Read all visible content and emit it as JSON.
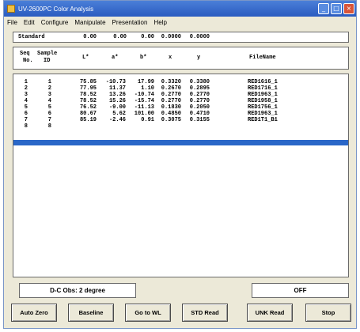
{
  "window": {
    "title": "UV-2600PC Color Analysis",
    "minimize": "_",
    "maximize": "□",
    "close": "×"
  },
  "menu": [
    "File",
    "Edit",
    "Configure",
    "Manipulate",
    "Presentation",
    "Help"
  ],
  "standard": {
    "label": "Standard",
    "values": [
      "0.00",
      "0.00",
      "0.00",
      "0.0000",
      "0.0000"
    ]
  },
  "columns": {
    "seq": [
      "Seq",
      "No."
    ],
    "sample": [
      "Sample",
      "ID"
    ],
    "labels": [
      "L*",
      "a*",
      "b*",
      "x",
      "y"
    ],
    "filename": "FileName"
  },
  "rows": [
    {
      "seq": "1",
      "sample": "1",
      "L": "75.85",
      "a": "-10.73",
      "b": "17.99",
      "x": "0.3320",
      "y": "0.3380",
      "file": "RED1616_1"
    },
    {
      "seq": "2",
      "sample": "2",
      "L": "77.95",
      "a": "11.37",
      "b": "1.10",
      "x": "0.2670",
      "y": "0.2895",
      "file": "RED1716_1"
    },
    {
      "seq": "3",
      "sample": "3",
      "L": "78.52",
      "a": "13.26",
      "b": "-10.74",
      "x": "0.2770",
      "y": "0.2770",
      "file": "RED1963_1"
    },
    {
      "seq": "4",
      "sample": "4",
      "L": "78.52",
      "a": "15.26",
      "b": "-15.74",
      "x": "0.2770",
      "y": "0.2770",
      "file": "RED1958_1"
    },
    {
      "seq": "5",
      "sample": "5",
      "L": "76.52",
      "a": "-9.00",
      "b": "-11.13",
      "x": "0.1830",
      "y": "0.2050",
      "file": "RED1756_1"
    },
    {
      "seq": "6",
      "sample": "6",
      "L": "80.67",
      "a": "5.62",
      "b": "101.00",
      "x": "0.4850",
      "y": "0.4710",
      "file": "RED1963_1"
    },
    {
      "seq": "7",
      "sample": "7",
      "L": "85.19",
      "a": "-2.46",
      "b": "0.91",
      "x": "0.3075",
      "y": "0.3155",
      "file": "RED1T1_B1"
    },
    {
      "seq": "8",
      "sample": "8",
      "L": "",
      "a": "",
      "b": "",
      "x": "",
      "y": "",
      "file": ""
    }
  ],
  "status": {
    "illuminant": "D-C  Obs: 2 degree",
    "state": "OFF"
  },
  "buttons": [
    "Auto Zero",
    "Baseline",
    "Go to WL",
    "STD Read",
    "UNK Read",
    "Stop"
  ]
}
